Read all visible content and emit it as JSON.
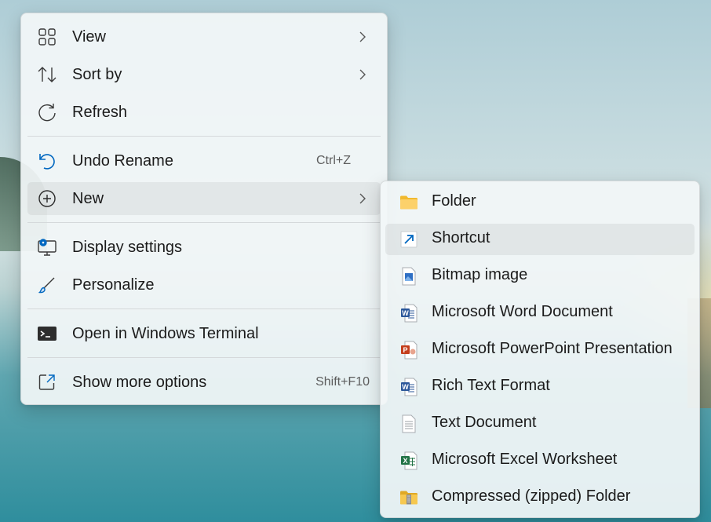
{
  "context_menu": {
    "items": [
      {
        "label": "View",
        "icon": "grid-icon",
        "has_submenu": true
      },
      {
        "label": "Sort by",
        "icon": "sort-icon",
        "has_submenu": true
      },
      {
        "label": "Refresh",
        "icon": "refresh-icon"
      },
      {
        "label": "Undo Rename",
        "icon": "undo-icon",
        "shortcut": "Ctrl+Z"
      },
      {
        "label": "New",
        "icon": "add-circle-icon",
        "has_submenu": true,
        "highlighted": true
      },
      {
        "label": "Display settings",
        "icon": "display-settings-icon"
      },
      {
        "label": "Personalize",
        "icon": "brush-icon"
      },
      {
        "label": "Open in Windows Terminal",
        "icon": "terminal-icon"
      },
      {
        "label": "Show more options",
        "icon": "expand-icon",
        "shortcut": "Shift+F10"
      }
    ]
  },
  "new_submenu": {
    "items": [
      {
        "label": "Folder",
        "icon": "folder-icon"
      },
      {
        "label": "Shortcut",
        "icon": "shortcut-icon",
        "highlighted": true
      },
      {
        "label": "Bitmap image",
        "icon": "bitmap-icon"
      },
      {
        "label": "Microsoft Word Document",
        "icon": "word-icon"
      },
      {
        "label": "Microsoft PowerPoint Presentation",
        "icon": "powerpoint-icon"
      },
      {
        "label": "Rich Text Format",
        "icon": "rtf-icon"
      },
      {
        "label": "Text Document",
        "icon": "text-document-icon"
      },
      {
        "label": "Microsoft Excel Worksheet",
        "icon": "excel-icon"
      },
      {
        "label": "Compressed (zipped) Folder",
        "icon": "zip-folder-icon"
      }
    ]
  },
  "colors": {
    "accent": "#0067c0",
    "menu_bg": "#f2f6f7",
    "word": "#2b579a",
    "powerpoint": "#c43e1c",
    "excel": "#217346",
    "folder": "#f8c44f"
  }
}
